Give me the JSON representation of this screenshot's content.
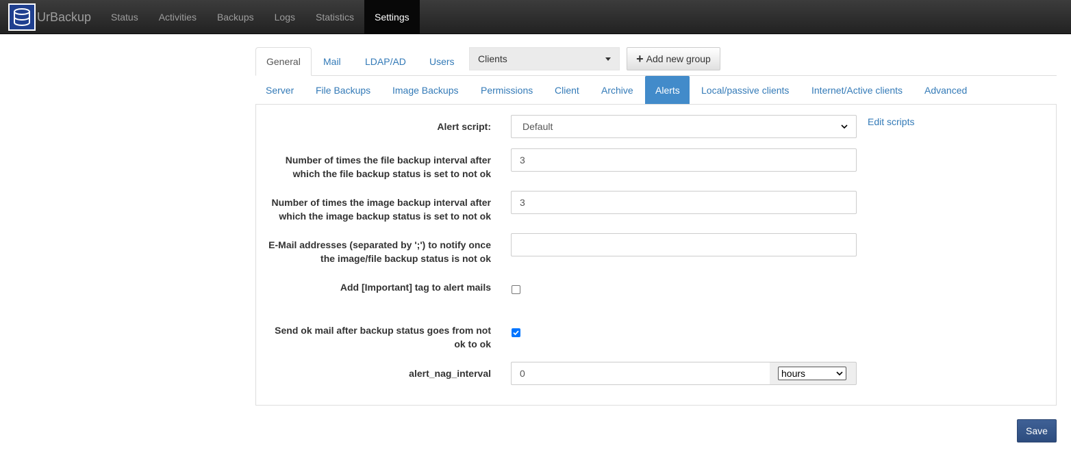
{
  "brand": {
    "name": "UrBackup"
  },
  "nav": {
    "items": [
      {
        "label": "Status"
      },
      {
        "label": "Activities"
      },
      {
        "label": "Backups"
      },
      {
        "label": "Logs"
      },
      {
        "label": "Statistics"
      },
      {
        "label": "Settings",
        "active": true
      }
    ]
  },
  "tabs": {
    "items": [
      {
        "label": "General",
        "active": true
      },
      {
        "label": "Mail"
      },
      {
        "label": "LDAP/AD"
      },
      {
        "label": "Users"
      }
    ],
    "group_select": {
      "value": "Clients"
    },
    "add_group_label": "Add new group"
  },
  "subtabs": {
    "items": [
      {
        "label": "Server"
      },
      {
        "label": "File Backups"
      },
      {
        "label": "Image Backups"
      },
      {
        "label": "Permissions"
      },
      {
        "label": "Client"
      },
      {
        "label": "Archive"
      },
      {
        "label": "Alerts",
        "active": true
      },
      {
        "label": "Local/passive clients"
      },
      {
        "label": "Internet/Active clients"
      },
      {
        "label": "Advanced"
      }
    ]
  },
  "form": {
    "alert_script": {
      "label": "Alert script:",
      "value": "Default",
      "edit_link": "Edit scripts"
    },
    "file_interval": {
      "label_line1": "Number of times the file backup interval after",
      "label_line2": "which the file backup status is set to not ok",
      "value": "3"
    },
    "image_interval": {
      "label_line1": "Number of times the image backup interval after",
      "label_line2": "which the image backup status is set to not ok",
      "value": "3"
    },
    "emails": {
      "label_line1": "E-Mail addresses (separated by ';') to notify once",
      "label_line2": "the image/file backup status is not ok",
      "value": ""
    },
    "important_tag": {
      "label": "Add [Important] tag to alert mails",
      "checked": false
    },
    "ok_mail": {
      "label_line1": "Send ok mail after backup status goes from not",
      "label_line2": "ok to ok",
      "checked": true
    },
    "nag_interval": {
      "label": "alert_nag_interval",
      "value": "0",
      "unit": "hours"
    }
  },
  "save_label": "Save",
  "colors": {
    "accent": "#428bca",
    "navbar": "#222222",
    "save": "#2d4c7e"
  }
}
